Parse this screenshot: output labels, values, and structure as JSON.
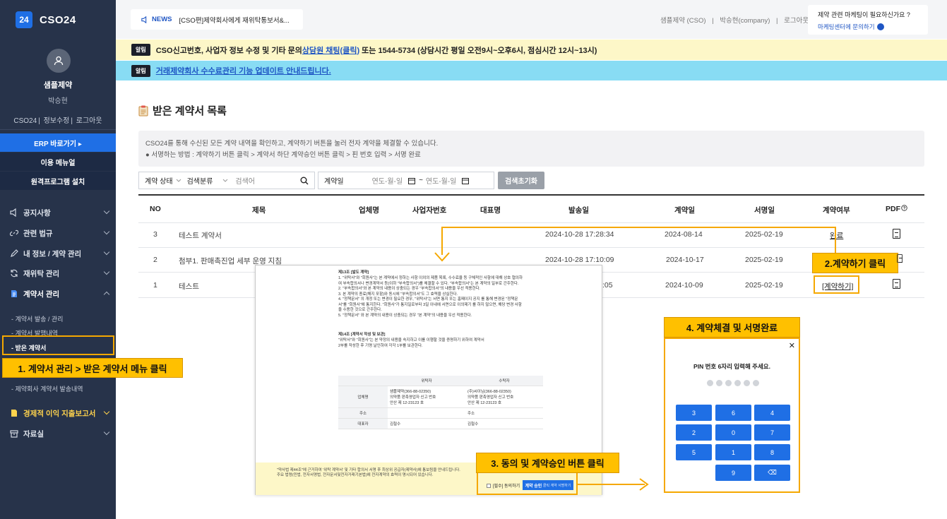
{
  "app": {
    "logo_badge": "24",
    "logo_text": "CSO24"
  },
  "sidebar": {
    "company": "샘플제약",
    "user": "박승현",
    "links": [
      "CSO24",
      "정보수정",
      "로그아웃"
    ],
    "erp_button": "ERP 바로가기 ▸",
    "manual_button": "이용 메뉴얼",
    "remote_button": "원격프로그램 설치",
    "menu": [
      {
        "label": "공지사항",
        "icon": "speaker-icon"
      },
      {
        "label": "관련 법규",
        "icon": "link-icon"
      },
      {
        "label": "내 정보 / 계약 관리",
        "icon": "pencil-icon"
      },
      {
        "label": "재위탁 관리",
        "icon": "refresh-icon"
      },
      {
        "label": "계약서 관리",
        "icon": "document-icon"
      }
    ],
    "submenu": [
      "- 계약서 발송 / 관리",
      "- 계약서 발행내역",
      "- 받은 계약서",
      "- 제약회사 계약서 발송내역"
    ],
    "menu_bottom": [
      {
        "label": "경제적 이익 지출보고서",
        "icon": "report-icon"
      },
      {
        "label": "자료실",
        "icon": "archive-icon"
      }
    ]
  },
  "topbar": {
    "news_tag": "NEWS",
    "news_text": "[CSO편]제약회사에게 재위탁통보서&...",
    "links": [
      "샘플제약 (CSO)",
      "|",
      "박승현(company)",
      "|",
      "로그아웃"
    ],
    "promo_title": "제약 관련 마케팅이 필요하신가요 ?",
    "promo_link": "마케팅센터에 문의하기"
  },
  "notices": {
    "badge": "알림",
    "notice1_pre": "CSO신고번호, 사업자 정보 수정 및 기타 문의 ",
    "notice1_link": "상담원 채팅(클릭)",
    "notice1_post": " 또는 1544-5734 (상담시간 평일 오전9시~오후6시, 점심시간 12시~13시)",
    "notice2": "거래제약회사 수수료관리 기능 업데이트 안내드립니다."
  },
  "page": {
    "title": "받은 계약서 목록",
    "desc1": "CSO24를 통해 수신된 모든 계약 내역을 확인하고, 계약하기 버튼을 눌러 전자 계약을 체결할 수 있습니다.",
    "desc2": "● 서명하는 방법 : 계약하기 버튼 클릭 > 계약서 하단 계약승인 버튼 클릭 > 핀 번호 입력 > 서명 완료"
  },
  "filters": {
    "status": "계약 상태",
    "category": "검색분류",
    "search_placeholder": "검색어",
    "date_label": "계약일",
    "date_from": "연도-월-일",
    "date_sep": "~",
    "date_to": "연도-월-일",
    "reset": "검색초기화"
  },
  "table": {
    "headers": [
      "NO",
      "제목",
      "업체명",
      "사업자번호",
      "대표명",
      "발송일",
      "계약일",
      "서명일",
      "계약여부",
      "PDF"
    ],
    "rows": [
      {
        "no": "3",
        "title": "테스트 계약서",
        "sent": "2024-10-28 17:28:34",
        "contract": "2024-08-14",
        "signed": "2025-02-19",
        "status": "완료"
      },
      {
        "no": "2",
        "title": "첨부1. 판매촉진업 세부 운영 지침",
        "sent": "2024-10-28 17:10:09",
        "contract": "2024-10-17",
        "signed": "2025-02-19",
        "status": ""
      },
      {
        "no": "1",
        "title": "테스트",
        "sent": ":05",
        "contract": "2024-10-09",
        "signed": "2025-02-19",
        "status": "[계약하기]"
      }
    ]
  },
  "contract_doc": {
    "section1_title": "제13조 [발도 계약]",
    "section1_lines": [
      "1. \"위탁사\"와 \"회원사\"는 본 계약에서 정하는 사항 이외의 제품 목록, 수수료율 등 구체적인 사항에 대해 상호 협의하",
      "여 부속합의서나 변경계약서 등(이하 \"부속합의서\")를 체결할 수 있다. \"부속합의서\"는 본 계약의 일부로 간주한다.",
      "2. \"부속합의서\"와 본 계약의 내용이 상충되는 경우 \"부속합의서\"의 내용을 우선 적용한다.",
      "3. 본 계약의 종료(해지 포함)와 동시에 \"부속합의서\"도 그 효력을 상실한다.",
      "4. \"정책문서\" 의 개정 또는 변경이 필요한 경우, \"위탁사\"는 서면 통지 또는 홈페이지 공지 를 통해 변경된 \"정책문",
      "서\"를 \"회원사\"에 통지한다. \"회원사\"가 통지일로부터 3일 이내에 서면으로 이의제기 를 하지 않으면, 해당 변경 사항",
      "을 수용한 것으로 간주한다.",
      "5. \"정책문서\" 와 본 계약의 내용이 상충되는 경우 \"본 계약\"의 내용을 우선 적용한다."
    ],
    "section2_title": "제14조 [계약서 작성 및 보관]",
    "section2_lines": [
      "\"위탁사\"와 \"회원사\"는 본 약정의 내용을 숙지하고 이를 이행할 것을 증명하기 위하여 계약서",
      "2부를 작성한 후 기명 날인하여 각각 1부를 보관한다."
    ],
    "table_head": [
      "위탁자",
      "수탁자"
    ],
    "table_rows": [
      {
        "label": "업체명",
        "a": "샘플제약(366-88-02350)\n의약품 판촉영업자 신고 번호\n안산 제 12-23123 호",
        "b": "(주)씨이님(366-88-02350)\n의약품 판촉영업자 신고 번호\n안산 제 12-23123 호"
      },
      {
        "label": "주소",
        "a": "",
        "b": "주소"
      },
      {
        "label": "대표자",
        "a": "김철수",
        "b": "김철수"
      }
    ],
    "footer_lines": [
      "\"약사법 제44조\"에 근거하여 '위탁 계약서' 및 기타 합의서 서명 후 최상위 공급자(제약사)에 통보됨을 안내드립니다.",
      "주요 법령(민법, 전자서명법, 전자문서및전자거래기본법)에 전자계약의 효력이 명시되어 있습니다."
    ],
    "agree_label": "[필수] 동의하기",
    "approve_button": "계약 승인",
    "approve_sub": "클릭 계약 서명하기"
  },
  "pin": {
    "close": "✕",
    "title": "PIN 번호 6자리 입력해 주세요.",
    "keys": [
      "3",
      "6",
      "4",
      "2",
      "0",
      "7",
      "5",
      "1",
      "8",
      "9",
      "⌫"
    ]
  },
  "callouts": {
    "step1": "1. 계약서 관리 > 받은 계약서 메뉴 클릭",
    "step2": "2.계약하기 클릭",
    "step3": "3. 동의 및 계약승인 버튼 클릭",
    "step4": "4. 계약체결 및 서명완료"
  },
  "colors": {
    "sidebar": "#27334a",
    "accent": "#1f6fe5",
    "callout": "#ffc000",
    "notice_yellow": "#fdf7c8",
    "notice_cyan": "#88dcf4"
  }
}
